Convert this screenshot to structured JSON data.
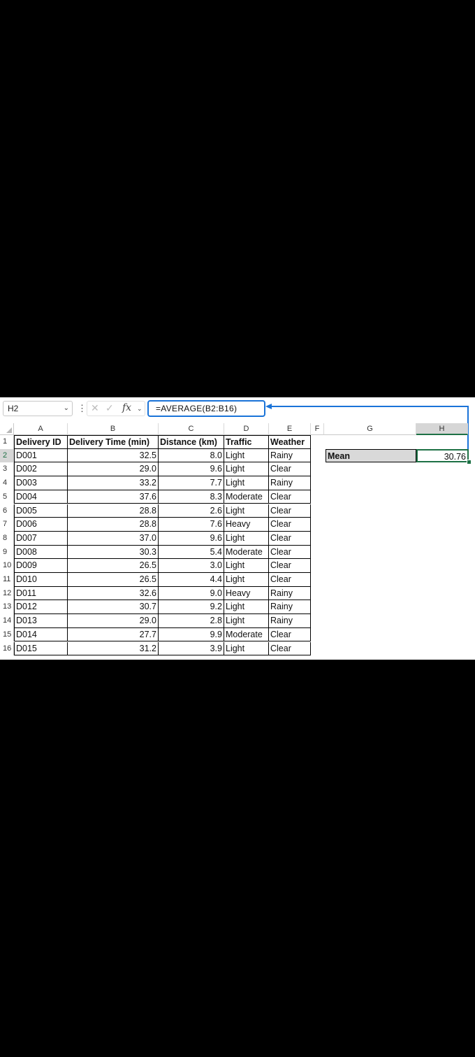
{
  "formula_bar": {
    "name_box": "H2",
    "formula": "=AVERAGE(B2:B16)",
    "fx_label": "fx"
  },
  "columns": [
    "A",
    "B",
    "C",
    "D",
    "E",
    "F",
    "G",
    "H"
  ],
  "rows": [
    "1",
    "2",
    "3",
    "4",
    "5",
    "6",
    "7",
    "8",
    "9",
    "10",
    "11",
    "12",
    "13",
    "14",
    "15",
    "16"
  ],
  "table": {
    "headers": [
      "Delivery ID",
      "Delivery Time (min)",
      "Distance (km)",
      "Traffic",
      "Weather"
    ],
    "rows": [
      [
        "D001",
        "32.5",
        "8.0",
        "Light",
        "Rainy"
      ],
      [
        "D002",
        "29.0",
        "9.6",
        "Light",
        "Clear"
      ],
      [
        "D003",
        "33.2",
        "7.7",
        "Light",
        "Rainy"
      ],
      [
        "D004",
        "37.6",
        "8.3",
        "Moderate",
        "Clear"
      ],
      [
        "D005",
        "28.8",
        "2.6",
        "Light",
        "Clear"
      ],
      [
        "D006",
        "28.8",
        "7.6",
        "Heavy",
        "Clear"
      ],
      [
        "D007",
        "37.0",
        "9.6",
        "Light",
        "Clear"
      ],
      [
        "D008",
        "30.3",
        "5.4",
        "Moderate",
        "Clear"
      ],
      [
        "D009",
        "26.5",
        "3.0",
        "Light",
        "Clear"
      ],
      [
        "D010",
        "26.5",
        "4.4",
        "Light",
        "Clear"
      ],
      [
        "D011",
        "32.6",
        "9.0",
        "Heavy",
        "Rainy"
      ],
      [
        "D012",
        "30.7",
        "9.2",
        "Light",
        "Rainy"
      ],
      [
        "D013",
        "29.0",
        "2.8",
        "Light",
        "Rainy"
      ],
      [
        "D014",
        "27.7",
        "9.9",
        "Moderate",
        "Clear"
      ],
      [
        "D015",
        "31.2",
        "3.9",
        "Light",
        "Clear"
      ]
    ]
  },
  "summary": {
    "label": "Mean",
    "value": "30.76"
  },
  "selected_cell": "H2",
  "colors": {
    "accent_blue": "#1a73d8",
    "selection_green": "#1e7145"
  }
}
